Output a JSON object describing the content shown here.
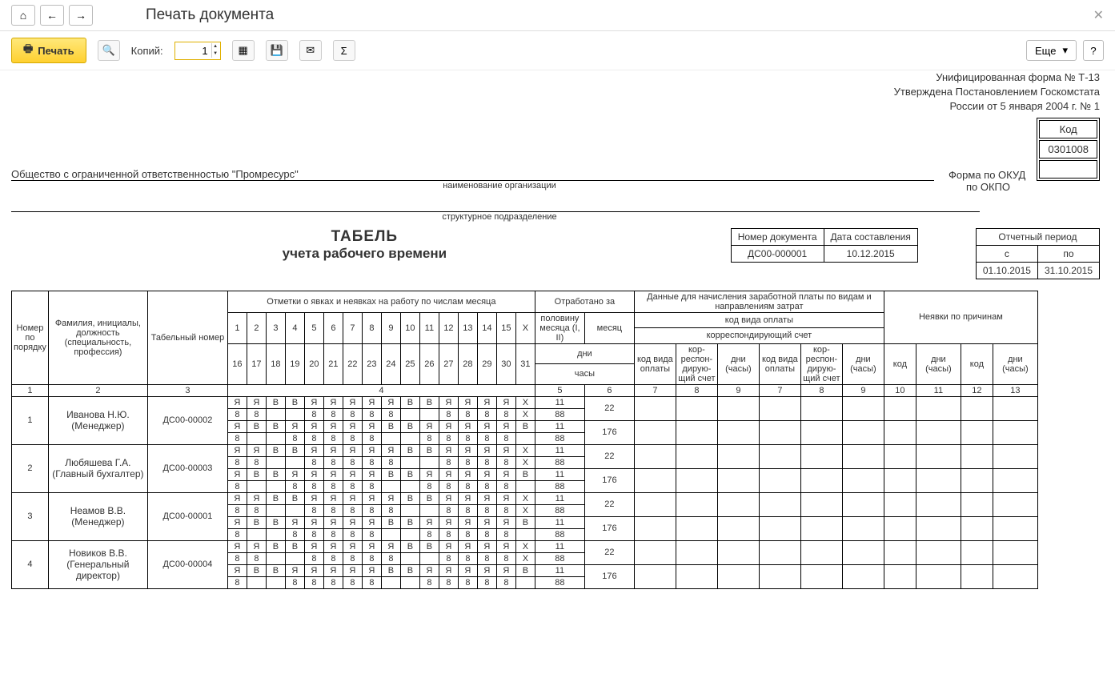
{
  "page_title": "Печать документа",
  "toolbar": {
    "print": "Печать",
    "copies_label": "Копий:",
    "copies_value": "1",
    "more": "Еще",
    "help": "?"
  },
  "header": {
    "form_line1": "Унифицированная форма № Т-13",
    "form_line2": "Утверждена Постановлением Госкомстата",
    "form_line3": "России от 5 января 2004 г. № 1",
    "code_header": "Код",
    "okud_label": "Форма по ОКУД",
    "okud_value": "0301008",
    "okpo_label": "по ОКПО",
    "org_name": "Общество с ограниченной ответственностью \"Промресурс\"",
    "org_caption": "наименование организации",
    "dept_caption": "структурное подразделение"
  },
  "doc_meta": {
    "title_main": "ТАБЕЛЬ",
    "title_sub": "учета  рабочего времени",
    "doc_num_label": "Номер документа",
    "doc_num": "ДС00-000001",
    "doc_date_label": "Дата составления",
    "doc_date": "10.12.2015",
    "period_label": "Отчетный период",
    "from_label": "с",
    "to_label": "по",
    "from": "01.10.2015",
    "to": "31.10.2015"
  },
  "columns": {
    "num": "Номер по порядку",
    "name": "Фамилия, инициалы, должность (специальность, профессия)",
    "tab": "Табельный номер",
    "marks": "Отметки о явках и неявках на работу по числам месяца",
    "worked": "Отработано за",
    "half": "половину месяца (I, II)",
    "month": "месяц",
    "days": "дни",
    "hours": "часы",
    "pay_data": "Данные для начисления заработной платы по видам и направлениям затрат",
    "pay_code": "код вида оплаты",
    "corr": "корреспондирующий счет",
    "pay_code_s": "код вида оплаты",
    "corr_s": "кор-респон-дирую-щий счет",
    "dh": "дни (часы)",
    "absence": "Неявки по причинам",
    "code": "код"
  },
  "index_row": [
    "1",
    "2",
    "3",
    "4",
    "5",
    "6",
    "7",
    "8",
    "9",
    "7",
    "8",
    "9",
    "10",
    "11",
    "12",
    "13"
  ],
  "employees": [
    {
      "num": "1",
      "name": "Иванова Н.Ю. (Менеджер)",
      "tab": "ДС00-00002",
      "row1": [
        "Я",
        "Я",
        "В",
        "В",
        "Я",
        "Я",
        "Я",
        "Я",
        "Я",
        "В",
        "В",
        "Я",
        "Я",
        "Я",
        "Я",
        "Х"
      ],
      "row2": [
        "8",
        "8",
        "",
        "",
        "8",
        "8",
        "8",
        "8",
        "8",
        "",
        "",
        "8",
        "8",
        "8",
        "8",
        "Х"
      ],
      "row3": [
        "Я",
        "В",
        "В",
        "Я",
        "Я",
        "Я",
        "Я",
        "Я",
        "В",
        "В",
        "Я",
        "Я",
        "Я",
        "Я",
        "Я",
        "В"
      ],
      "row4": [
        "8",
        "",
        "",
        "8",
        "8",
        "8",
        "8",
        "8",
        "",
        "",
        "8",
        "8",
        "8",
        "8",
        "8",
        ""
      ],
      "half1_d": "11",
      "half1_h": "88",
      "half2_d": "11",
      "half2_h": "88",
      "month_d": "22",
      "month_h": "176"
    },
    {
      "num": "2",
      "name": "Любяшева Г.А. (Главный бухгалтер)",
      "tab": "ДС00-00003",
      "row1": [
        "Я",
        "Я",
        "В",
        "В",
        "Я",
        "Я",
        "Я",
        "Я",
        "Я",
        "В",
        "В",
        "Я",
        "Я",
        "Я",
        "Я",
        "Х"
      ],
      "row2": [
        "8",
        "8",
        "",
        "",
        "8",
        "8",
        "8",
        "8",
        "8",
        "",
        "",
        "8",
        "8",
        "8",
        "8",
        "Х"
      ],
      "row3": [
        "Я",
        "В",
        "В",
        "Я",
        "Я",
        "Я",
        "Я",
        "Я",
        "В",
        "В",
        "Я",
        "Я",
        "Я",
        "Я",
        "Я",
        "В"
      ],
      "row4": [
        "8",
        "",
        "",
        "8",
        "8",
        "8",
        "8",
        "8",
        "",
        "",
        "8",
        "8",
        "8",
        "8",
        "8",
        ""
      ],
      "half1_d": "11",
      "half1_h": "88",
      "half2_d": "11",
      "half2_h": "88",
      "month_d": "22",
      "month_h": "176"
    },
    {
      "num": "3",
      "name": "Неамов В.В. (Менеджер)",
      "tab": "ДС00-00001",
      "row1": [
        "Я",
        "Я",
        "В",
        "В",
        "Я",
        "Я",
        "Я",
        "Я",
        "Я",
        "В",
        "В",
        "Я",
        "Я",
        "Я",
        "Я",
        "Х"
      ],
      "row2": [
        "8",
        "8",
        "",
        "",
        "8",
        "8",
        "8",
        "8",
        "8",
        "",
        "",
        "8",
        "8",
        "8",
        "8",
        "Х"
      ],
      "row3": [
        "Я",
        "В",
        "В",
        "Я",
        "Я",
        "Я",
        "Я",
        "Я",
        "В",
        "В",
        "Я",
        "Я",
        "Я",
        "Я",
        "Я",
        "В"
      ],
      "row4": [
        "8",
        "",
        "",
        "8",
        "8",
        "8",
        "8",
        "8",
        "",
        "",
        "8",
        "8",
        "8",
        "8",
        "8",
        ""
      ],
      "half1_d": "11",
      "half1_h": "88",
      "half2_d": "11",
      "half2_h": "88",
      "month_d": "22",
      "month_h": "176"
    },
    {
      "num": "4",
      "name": "Новиков В.В. (Генеральный директор)",
      "tab": "ДС00-00004",
      "row1": [
        "Я",
        "Я",
        "В",
        "В",
        "Я",
        "Я",
        "Я",
        "Я",
        "Я",
        "В",
        "В",
        "Я",
        "Я",
        "Я",
        "Я",
        "Х"
      ],
      "row2": [
        "8",
        "8",
        "",
        "",
        "8",
        "8",
        "8",
        "8",
        "8",
        "",
        "",
        "8",
        "8",
        "8",
        "8",
        "Х"
      ],
      "row3": [
        "Я",
        "В",
        "В",
        "Я",
        "Я",
        "Я",
        "Я",
        "Я",
        "В",
        "В",
        "Я",
        "Я",
        "Я",
        "Я",
        "Я",
        "В"
      ],
      "row4": [
        "8",
        "",
        "",
        "8",
        "8",
        "8",
        "8",
        "8",
        "",
        "",
        "8",
        "8",
        "8",
        "8",
        "8",
        ""
      ],
      "half1_d": "11",
      "half1_h": "88",
      "half2_d": "11",
      "half2_h": "88",
      "month_d": "22",
      "month_h": "176"
    }
  ],
  "days_top": [
    "1",
    "2",
    "3",
    "4",
    "5",
    "6",
    "7",
    "8",
    "9",
    "10",
    "11",
    "12",
    "13",
    "14",
    "15",
    "Х"
  ],
  "days_bot": [
    "16",
    "17",
    "18",
    "19",
    "20",
    "21",
    "22",
    "23",
    "24",
    "25",
    "26",
    "27",
    "28",
    "29",
    "30",
    "31"
  ]
}
